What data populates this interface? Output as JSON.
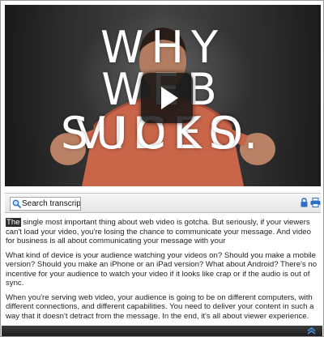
{
  "video": {
    "title_lines": [
      "WHY",
      "WEB VIDEO",
      "SUCKS."
    ],
    "play_icon": "play-icon"
  },
  "search": {
    "value": "Search transcript...",
    "icon": "search-icon"
  },
  "toolbar": {
    "icons": [
      "lock-icon",
      "print-icon"
    ]
  },
  "transcript": {
    "highlighted_word": "The",
    "paragraphs": [
      " single most important thing about web video is gotcha. But seriously, if your viewers can't load your video, you're losing the chance to communicate your message. And video for business is all about communicating your message with your",
      "What kind of device is your audience watching your videos on? Should you make a mobile version? Should you make an iPhone or an iPad version? What about Android? There's no incentive for your audience to watch your video if it looks like crap or if the audio is out of sync.",
      "When you're serving web video, your audience is going to be on different computers, with different connections, and different capabilities. You need to deliver your content in such a way that it doesn't detract from the message. In the end, it's all about viewer experience. Here's to web video that doesn't suck."
    ]
  },
  "footer": {
    "icon": "collapse-icon"
  },
  "colors": {
    "accent_blue": "#2f6fc4",
    "footer_dark": "#2a2a2a",
    "highlight_bg": "#2d2d2d"
  }
}
